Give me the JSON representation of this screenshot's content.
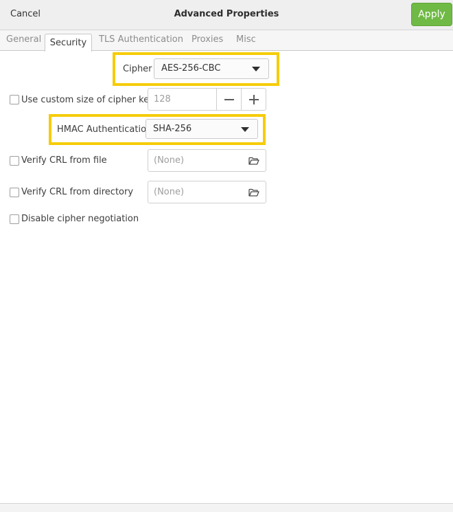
{
  "header": {
    "cancel_label": "Cancel",
    "title": "Advanced Properties",
    "apply_label": "Apply"
  },
  "tabs": [
    {
      "label": "General",
      "active": false
    },
    {
      "label": "Security",
      "active": true
    },
    {
      "label": "TLS Authentication",
      "active": false
    },
    {
      "label": "Proxies",
      "active": false
    },
    {
      "label": "Misc",
      "active": false
    }
  ],
  "security": {
    "cipher": {
      "label": "Cipher",
      "value": "AES-256-CBC"
    },
    "custom_key_size": {
      "label": "Use custom size of cipher key",
      "checked": false,
      "value": "128"
    },
    "hmac": {
      "label": "HMAC Authentication",
      "value": "SHA-256"
    },
    "verify_crl_file": {
      "label": "Verify CRL from file",
      "checked": false,
      "value": "(None)"
    },
    "verify_crl_dir": {
      "label": "Verify CRL from directory",
      "checked": false,
      "value": "(None)"
    },
    "disable_negotiation": {
      "label": "Disable cipher negotiation",
      "checked": false
    }
  },
  "icons": {
    "dropdown": "triangle-down",
    "minus": "minus-icon",
    "plus": "plus-icon",
    "folder": "folder-open-icon"
  },
  "colors": {
    "accent": "#6fb945",
    "highlight": "#f6cc06"
  }
}
